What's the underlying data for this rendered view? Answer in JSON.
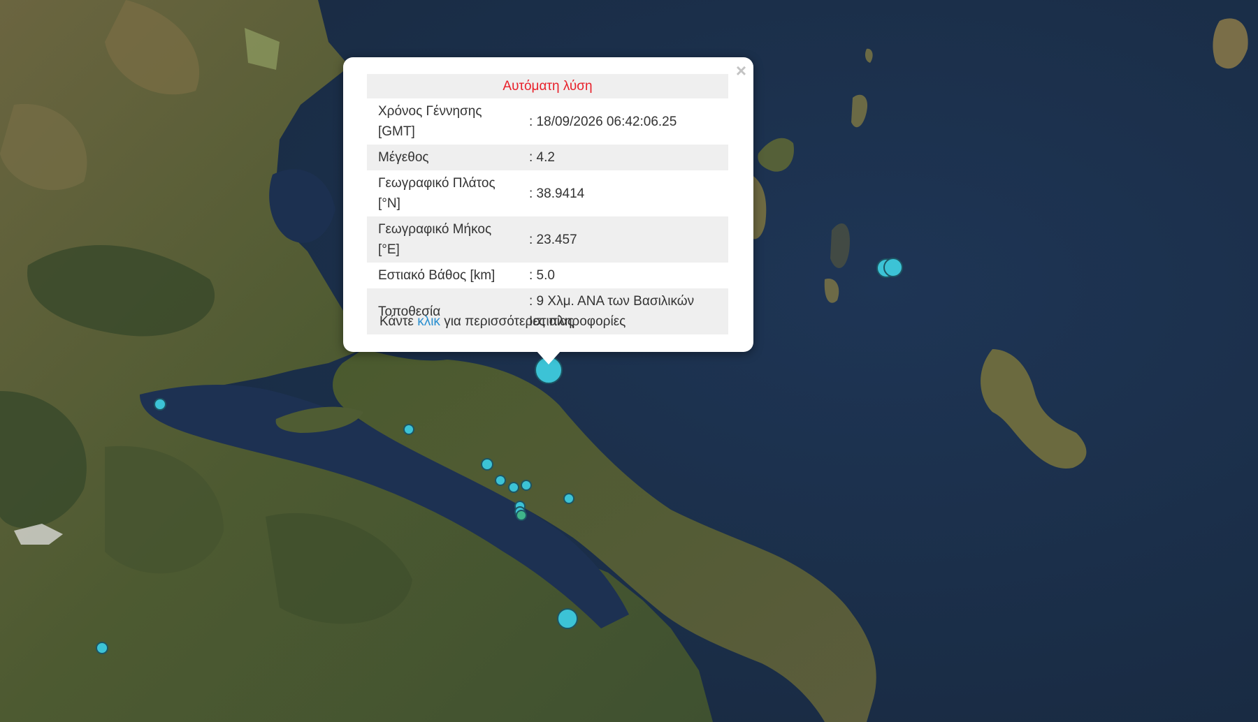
{
  "popup": {
    "header": "Αυτόματη λύση",
    "close": "×",
    "rows": [
      {
        "label": "Χρόνος Γέννησης [GMT]",
        "value": ": 18/09/2026 06:42:06.25"
      },
      {
        "label": "Μέγεθος",
        "value": ": 4.2"
      },
      {
        "label": "Γεωγραφικό Πλάτος [°N]",
        "value": ": 38.9414"
      },
      {
        "label": "Γεωγραφικό Μήκος [°E]",
        "value": ": 23.457"
      },
      {
        "label": "Εστιακό Βάθος [km]",
        "value": ": 5.0"
      },
      {
        "label": "Τοποθεσία",
        "value": ": 9 Χλμ. ΑΝΑ των Βασιλικών Ιστιαίας"
      }
    ],
    "footer_before": "Κάντε ",
    "footer_link": "κλικ",
    "footer_after": " για περισσότερες πληροφορίες"
  },
  "colors": {
    "sea": "#1c3050",
    "land": "#4a5a30",
    "marker": "#3cc3d6",
    "marker_recent": "#3fb58a",
    "header_text": "#e8202a",
    "link": "#2a8fd0"
  },
  "map": {
    "basemap": "satellite imagery",
    "markers": [
      {
        "id": "selected-event",
        "lat": 38.9414,
        "lon": 23.457,
        "magnitude": 4.2
      }
    ]
  }
}
